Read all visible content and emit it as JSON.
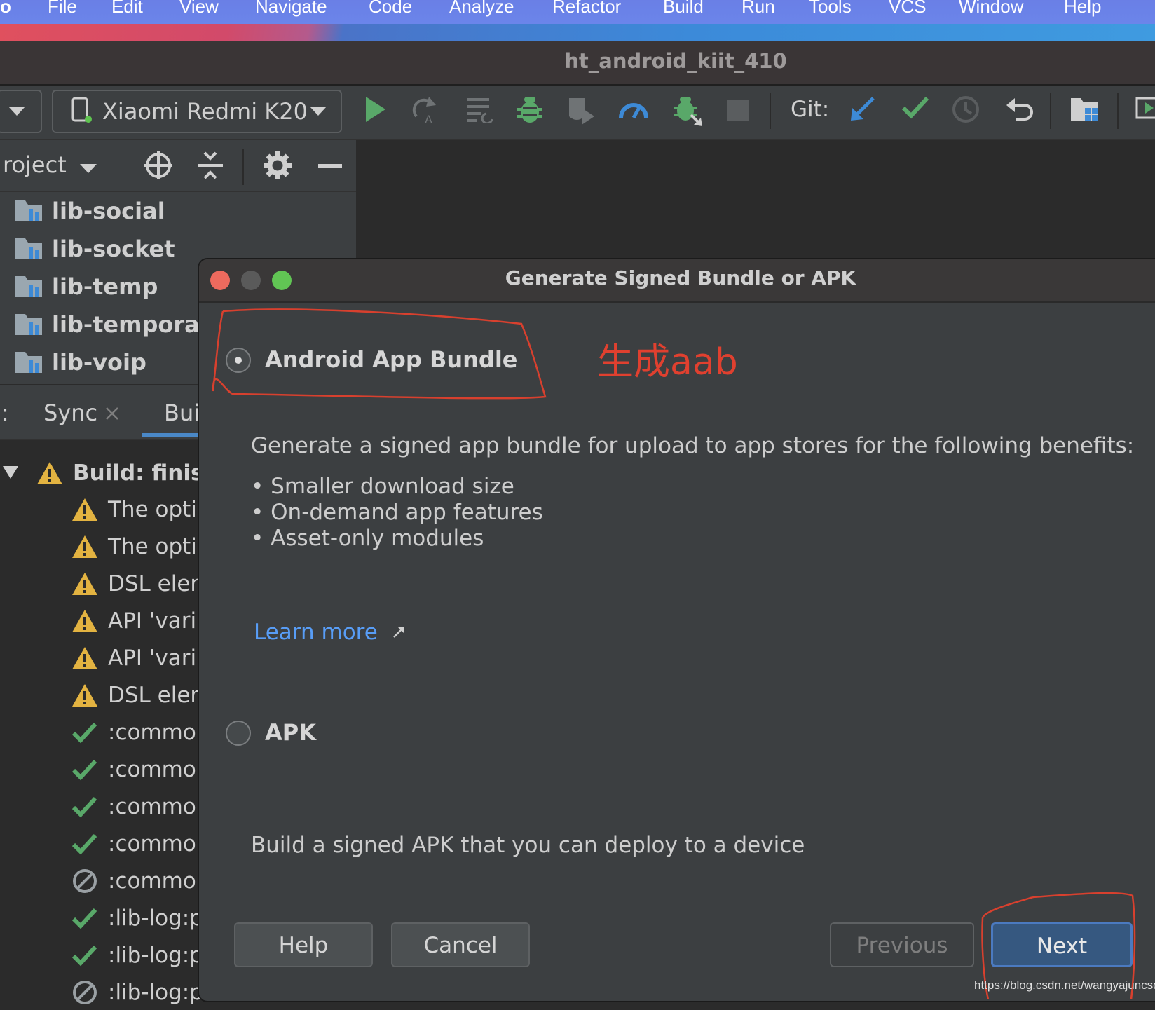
{
  "menubar": {
    "items": [
      "o",
      "File",
      "Edit",
      "View",
      "Navigate",
      "Code",
      "Analyze",
      "Refactor",
      "Build",
      "Run",
      "Tools",
      "VCS",
      "Window",
      "Help"
    ]
  },
  "window": {
    "title": "ht_android_kiit_410"
  },
  "toolbar": {
    "device": "Xiaomi Redmi K20",
    "git_label": "Git:"
  },
  "project_panel": {
    "title": "roject",
    "items": [
      "lib-social",
      "lib-socket",
      "lib-temp",
      "lib-temporar",
      "lib-voip"
    ]
  },
  "build_panel": {
    "tabs": [
      ":",
      "Sync",
      "Bui"
    ],
    "root": "Build: finish",
    "rows": [
      {
        "icon": "warning",
        "text": "The opti"
      },
      {
        "icon": "warning",
        "text": "The opti"
      },
      {
        "icon": "warning",
        "text": "DSL elem"
      },
      {
        "icon": "warning",
        "text": "API 'varia"
      },
      {
        "icon": "warning",
        "text": "API 'varia"
      },
      {
        "icon": "warning",
        "text": "DSL elem"
      },
      {
        "icon": "check",
        "text": ":common"
      },
      {
        "icon": "check",
        "text": ":common"
      },
      {
        "icon": "check",
        "text": ":common"
      },
      {
        "icon": "check",
        "text": ":common"
      },
      {
        "icon": "skipped",
        "text": ":common"
      },
      {
        "icon": "check",
        "text": ":lib-log:p"
      },
      {
        "icon": "check",
        "text": ":lib-log:p"
      },
      {
        "icon": "skipped",
        "text": ":lib-log:p"
      }
    ]
  },
  "dialog": {
    "title": "Generate Signed Bundle or APK",
    "option_bundle": "Android App Bundle",
    "bundle_desc": "Generate a signed app bundle for upload to app stores for the following benefits:",
    "benefits": [
      "Smaller download size",
      "On-demand app features",
      "Asset-only modules"
    ],
    "learn_more": "Learn more",
    "option_apk": "APK",
    "apk_desc": "Build a signed APK that you can deploy to a device",
    "selected": "Android App Bundle",
    "buttons": {
      "help": "Help",
      "cancel": "Cancel",
      "previous": "Previous",
      "next": "Next"
    }
  },
  "annotation": {
    "text": "生成aab",
    "color": "#e0402f"
  },
  "watermark": "https://blog.csdn.net/wangyajuncsd",
  "colors": {
    "accent_blue": "#589df6",
    "run_green": "#59a869",
    "warning_yellow": "#e3b341",
    "primary_button": "#365880"
  }
}
